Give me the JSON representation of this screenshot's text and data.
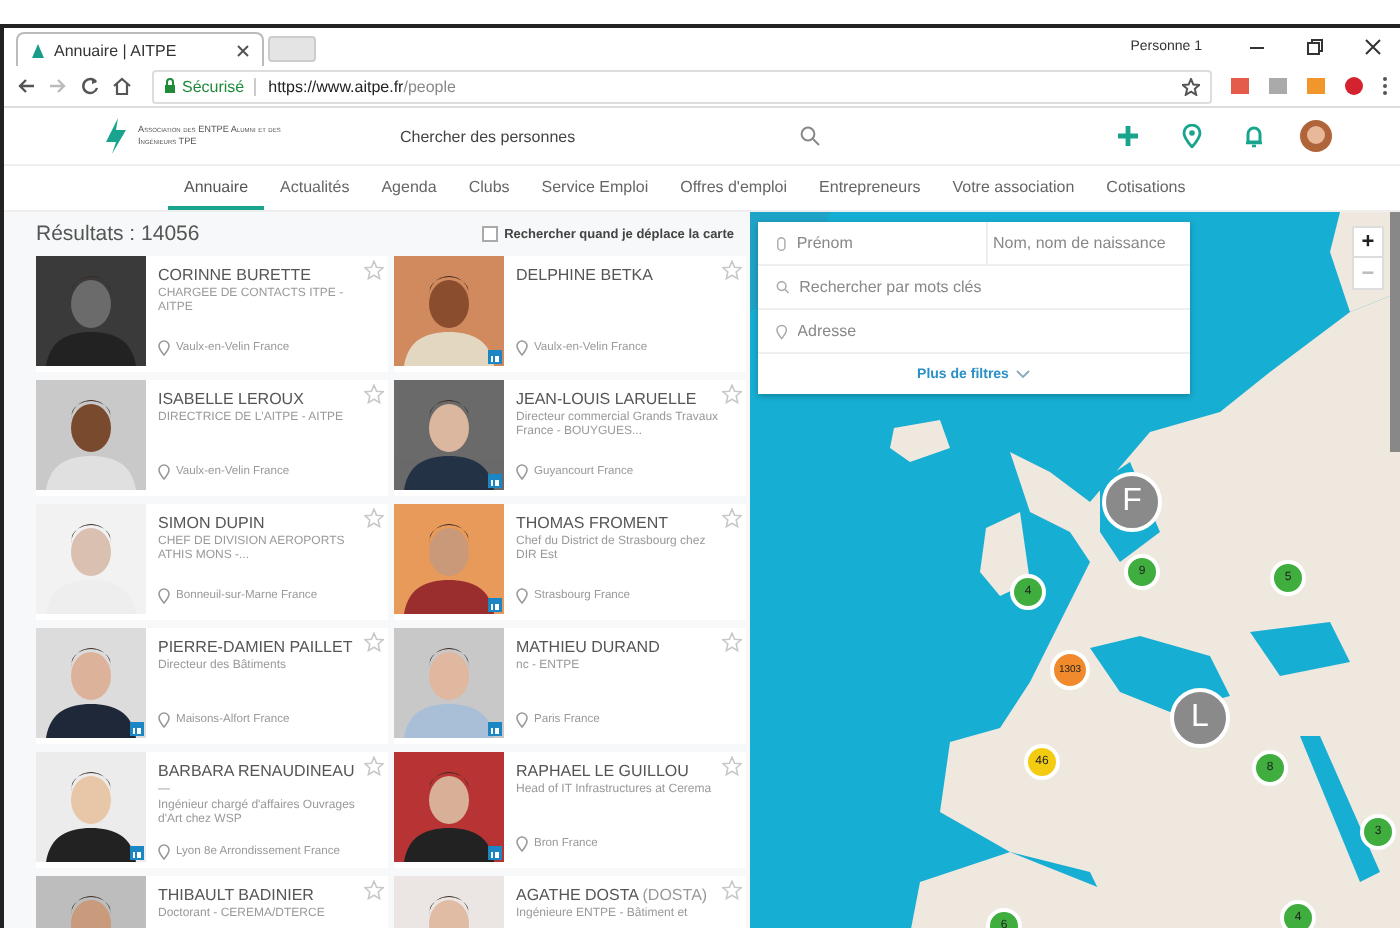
{
  "browser": {
    "tab_title": "Annuaire | AITPE",
    "profile": "Personne 1",
    "secure_label": "Sécurisé",
    "url_host": "https://www.aitpe.fr",
    "url_path": "/people"
  },
  "header": {
    "logo_text": "Association des ENTPE Alumni et des Ingénieurs TPE",
    "search_placeholder": "Chercher des personnes"
  },
  "nav": [
    {
      "label": "Annuaire",
      "selected": true
    },
    {
      "label": "Actualités",
      "selected": false
    },
    {
      "label": "Agenda",
      "selected": false
    },
    {
      "label": "Clubs",
      "selected": false
    },
    {
      "label": "Service Emploi",
      "selected": false
    },
    {
      "label": "Offres d'emploi",
      "selected": false
    },
    {
      "label": "Entrepreneurs",
      "selected": false
    },
    {
      "label": "Votre association",
      "selected": false
    },
    {
      "label": "Cotisations",
      "selected": false
    }
  ],
  "results": {
    "count_label": "Résultats : 14056",
    "move_search_label": "Rechercher quand je déplace la carte",
    "move_search_checked": false
  },
  "people": [
    {
      "name": "CORINNE BURETTE",
      "title": "CHARGEE DE CONTACTS ITPE - AITPE",
      "location": "Vaulx-en-Velin France",
      "linkedin": false
    },
    {
      "name": "DELPHINE BETKA",
      "location": "Vaulx-en-Velin France",
      "linkedin": true
    },
    {
      "name": "ISABELLE LEROUX",
      "title": "DIRECTRICE DE L'AITPE - AITPE",
      "location": "Vaulx-en-Velin France",
      "linkedin": false
    },
    {
      "name": "JEAN-LOUIS LARUELLE",
      "title": "Directeur commercial Grands Travaux France - BOUYGUES...",
      "location": "Guyancourt France",
      "linkedin": true
    },
    {
      "name": "SIMON DUPIN",
      "title": "CHEF DE DIVISION AEROPORTS ATHIS MONS -...",
      "location": "Bonneuil-sur-Marne France",
      "linkedin": false
    },
    {
      "name": "THOMAS FROMENT",
      "title": "Chef du District de Strasbourg chez DIR Est",
      "location": "Strasbourg France",
      "linkedin": true
    },
    {
      "name": "PIERRE-DAMIEN PAILLET",
      "title": "Directeur des Bâtiments",
      "location": "Maisons-Alfort France",
      "linkedin": true
    },
    {
      "name": "MATHIEU DURAND",
      "title": "nc - ENTPE",
      "location": "Paris France",
      "linkedin": true
    },
    {
      "name": "BARBARA RENAUDINEAU",
      "title_prefix": "—",
      "title": "Ingénieur chargé d'affaires Ouvrages d'Art chez WSP",
      "location": "Lyon 8e Arrondissement France",
      "linkedin": true
    },
    {
      "name": "RAPHAEL LE GUILLOU",
      "title": "Head of IT Infrastructures at Cerema",
      "location": "Bron France",
      "linkedin": true
    },
    {
      "name": "THIBAULT BADINIER",
      "title": "Doctorant - CEREMA/DTERCE"
    },
    {
      "name": "AGATHE DOSTA",
      "alt_name": "(DOSTA)",
      "title": "Ingénieure ENTPE - Bâtiment et"
    }
  ],
  "map_filters": {
    "first_name_placeholder": "Prénom",
    "last_name_placeholder": "Nom, nom de naissance",
    "keywords_placeholder": "Rechercher par mots clés",
    "address_placeholder": "Adresse",
    "more_filters": "Plus de filtres"
  },
  "map_zoom": {
    "zoom_in": "+",
    "zoom_out": "−"
  },
  "map_markers": [
    {
      "kind": "person",
      "label": "F",
      "color": "#8a8a8a"
    },
    {
      "kind": "cluster",
      "label": "9",
      "color": "#3fae3f"
    },
    {
      "kind": "cluster",
      "label": "4",
      "color": "#3fae3f"
    },
    {
      "kind": "cluster",
      "label": "5",
      "color": "#3fae3f"
    },
    {
      "kind": "cluster",
      "label": "1303",
      "color": "#f08a2c"
    },
    {
      "kind": "person",
      "label": "L",
      "color": "#8a8a8a"
    },
    {
      "kind": "cluster",
      "label": "46",
      "color": "#f3cc12"
    },
    {
      "kind": "cluster",
      "label": "8",
      "color": "#3fae3f"
    },
    {
      "kind": "cluster",
      "label": "3",
      "color": "#3fae3f"
    },
    {
      "kind": "cluster",
      "label": "6",
      "color": "#3fae3f"
    },
    {
      "kind": "cluster",
      "label": "4",
      "color": "#3fae3f"
    }
  ]
}
